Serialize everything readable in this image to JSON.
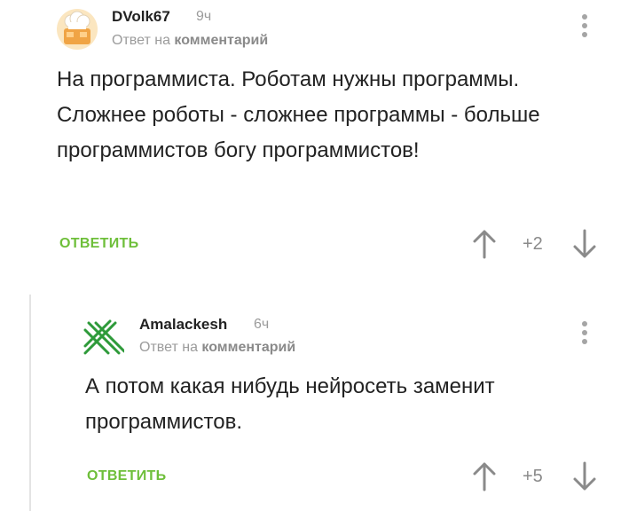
{
  "comments": [
    {
      "author": "DVolk67",
      "time": "9ч",
      "reply_prefix": "Ответ на",
      "reply_link": "комментарий",
      "text": "На программиста. Роботам нужны программы. Сложнее роботы - сложнее программы - больше программистов богу программистов!",
      "reply_label": "ОТВЕТИТЬ",
      "score": "+2",
      "avatar_icon": "chef-hat-avatar-icon"
    },
    {
      "author": "Amalackesh",
      "time": "6ч",
      "reply_prefix": "Ответ на",
      "reply_link": "комментарий",
      "text": "А потом какая нибудь нейросеть заменит программистов.",
      "reply_label": "ОТВЕТИТЬ",
      "score": "+5",
      "avatar_icon": "green-lines-avatar-icon"
    }
  ],
  "colors": {
    "accent_green": "#6ebf3a",
    "muted_text": "#9b9b9b",
    "icon_gray": "#a5a5a5"
  }
}
